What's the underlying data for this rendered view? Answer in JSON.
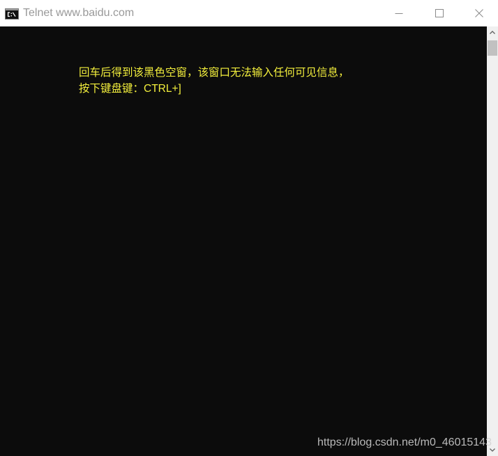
{
  "window": {
    "title": "Telnet www.baidu.com",
    "title_icon": "console-icon",
    "minimize_icon": "minimize-icon",
    "maximize_icon": "maximize-icon",
    "close_icon": "close-icon"
  },
  "console": {
    "lines": [
      "回车后得到该黑色空窗，该窗口无法输入任何可见信息，",
      "按下键盘键：CTRL+]"
    ]
  },
  "scrollbar": {
    "up_icon": "chevron-up-icon",
    "down_icon": "chevron-down-icon",
    "scroll_position": 0
  },
  "watermark": "https://blog.csdn.net/m0_46015143",
  "colors": {
    "title_bar": "#ffffff",
    "title_text": "#999999",
    "console_bg": "#0c0c0c",
    "annotation_text": "#f2ee3c",
    "scrollbar_track": "#f0f0f0",
    "scrollbar_thumb": "#c1c1c1"
  }
}
